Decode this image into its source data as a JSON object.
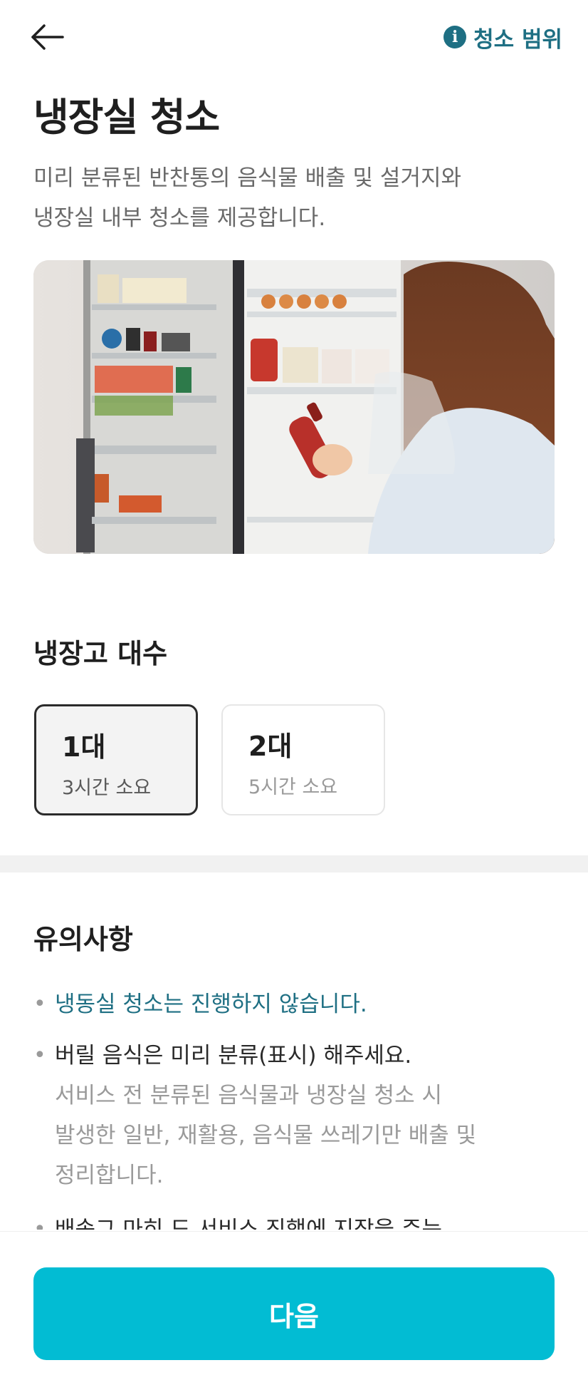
{
  "header": {
    "back_icon": "arrow-left-icon",
    "info_icon": "info-icon",
    "info_icon_glyph": "i",
    "scope_label": "청소 범위"
  },
  "page": {
    "title": "냉장실 청소",
    "description": "미리 분류된 반찬통의 음식물 배출 및 설거지와\n냉장실 내부 청소를 제공합니다."
  },
  "hero_image": {
    "subject": "woman-opening-refrigerator-photo"
  },
  "fridge_count": {
    "title": "냉장고 대수",
    "options": [
      {
        "label": "1대",
        "duration": "3시간 소요",
        "selected": true
      },
      {
        "label": "2대",
        "duration": "5시간 소요",
        "selected": false
      }
    ]
  },
  "notices": {
    "title": "유의사항",
    "bullet": "•",
    "items": [
      {
        "main": "냉동실 청소는 진행하지 않습니다.",
        "highlight": true
      },
      {
        "main": "버릴 음식은 미리 분류(표시) 해주세요.",
        "sub": "서비스 전 분류된 음식물과 냉장실 청소 시\n발생한 일반, 재활용, 음식물 쓰레기만 배출 및\n정리합니다."
      },
      {
        "main": "배송그 마히 드 서비스 진행에 지장을 주는"
      }
    ]
  },
  "footer": {
    "next_label": "다음"
  },
  "colors": {
    "accent_teal": "#1e6f83",
    "primary_button": "#02bcd3",
    "selected_border": "#2b2b2b"
  }
}
